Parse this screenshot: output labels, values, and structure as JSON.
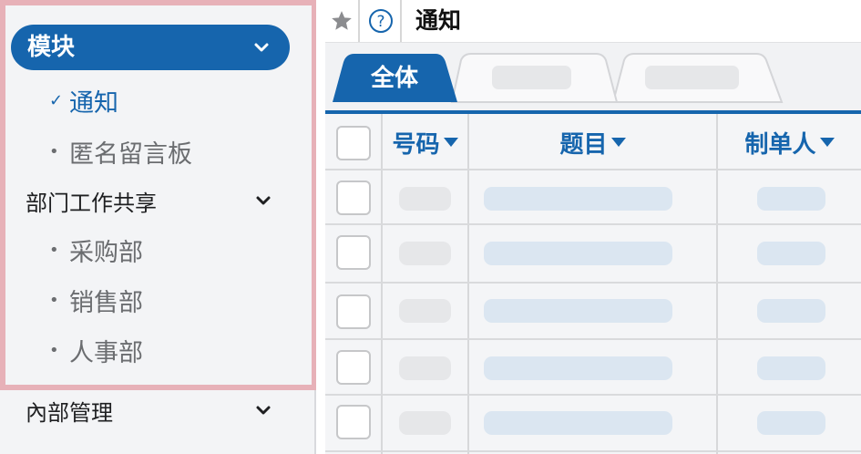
{
  "sidebar": {
    "module_header": {
      "label": "模块",
      "icon": "chevron-down-icon"
    },
    "module_items": [
      {
        "label": "通知",
        "marker": "✓",
        "active": true
      },
      {
        "label": "匿名留言板",
        "marker": "•",
        "active": false
      }
    ],
    "sections": [
      {
        "label": "部门工作共享",
        "icon": "chevron-down-icon",
        "items": [
          {
            "label": "采购部",
            "marker": "•"
          },
          {
            "label": "销售部",
            "marker": "•"
          },
          {
            "label": "人事部",
            "marker": "•"
          }
        ]
      },
      {
        "label": "內部管理",
        "icon": "chevron-down-icon"
      }
    ]
  },
  "topbar": {
    "star_icon": "star-icon",
    "help_icon": "help-circle-icon",
    "help_glyph": "?",
    "title": "通知"
  },
  "tabs": {
    "active_label": "全体",
    "tab_count": 3
  },
  "table": {
    "columns": [
      {
        "key": "checkbox",
        "label": ""
      },
      {
        "key": "number",
        "label": "号码",
        "sortable": true
      },
      {
        "key": "subject",
        "label": "题目",
        "sortable": true
      },
      {
        "key": "creator",
        "label": "制单人",
        "sortable": true
      }
    ],
    "row_count": 5
  },
  "colors": {
    "accent": "#1665ad",
    "sidebar_bg": "#f3f4f6",
    "highlight_border": "#e7b1b8",
    "placeholder_gray": "#e6e7e9",
    "placeholder_blue": "#dbe6f1"
  }
}
